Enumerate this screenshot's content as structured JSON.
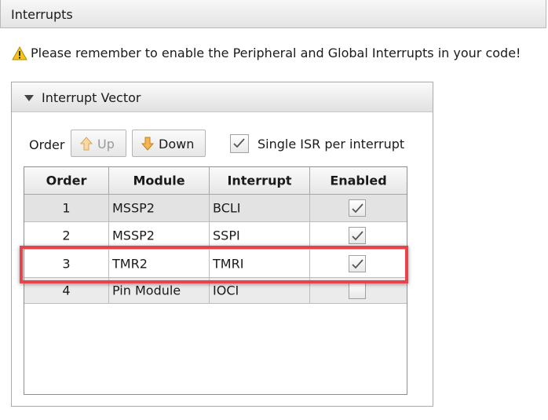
{
  "window": {
    "title": "Interrupts"
  },
  "warning": {
    "text": "Please remember to enable the Peripheral and Global Interrupts in your code!",
    "icon": "warning-icon"
  },
  "panel": {
    "title": "Interrupt Vector",
    "order_label": "Order",
    "up_button": "Up",
    "down_button": "Down",
    "single_isr": {
      "label": "Single ISR per interrupt",
      "checked": true
    }
  },
  "table": {
    "columns": [
      "Order",
      "Module",
      "Interrupt",
      "Enabled"
    ],
    "rows": [
      {
        "order": "1",
        "module": "MSSP2",
        "interrupt": "BCLI",
        "enabled": true
      },
      {
        "order": "2",
        "module": "MSSP2",
        "interrupt": "SSPI",
        "enabled": true
      },
      {
        "order": "3",
        "module": "TMR2",
        "interrupt": "TMRI",
        "enabled": true
      },
      {
        "order": "4",
        "module": "Pin Module",
        "interrupt": "IOCI",
        "enabled": false
      }
    ],
    "highlighted_row": 3
  },
  "colors": {
    "highlight": "#e8434b",
    "warning": "#f5c518",
    "arrow": "#f0a030"
  }
}
